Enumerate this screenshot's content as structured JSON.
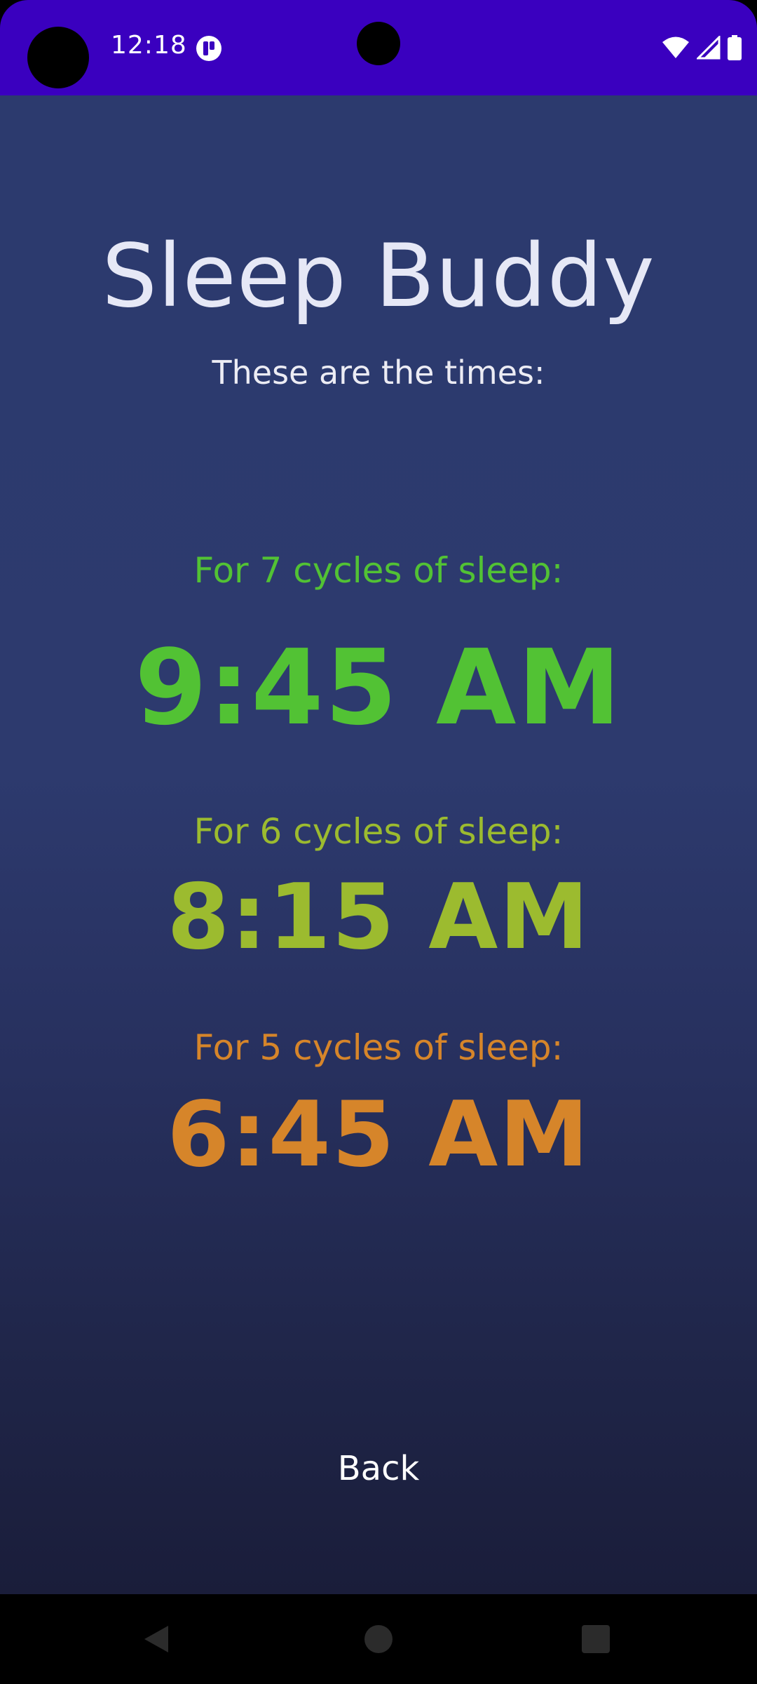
{
  "status_bar": {
    "time": "12:18",
    "icons": [
      "app-notification-icon",
      "wifi-icon",
      "cellular-signal-icon",
      "battery-icon"
    ]
  },
  "app": {
    "title": "Sleep Buddy",
    "subtitle": "These are the times:",
    "results": [
      {
        "label": "For 7 cycles of sleep:",
        "time": "9:45 AM",
        "color": "#52c234"
      },
      {
        "label": "For 6 cycles of sleep:",
        "time": "8:15 AM",
        "color": "#9cbb2f"
      },
      {
        "label": "For 5 cycles of sleep:",
        "time": "6:45 AM",
        "color": "#d6852a"
      }
    ],
    "back_label": "Back"
  },
  "colors": {
    "status_bar": "#3a00bf",
    "background_top": "#2c3a6e",
    "background_bottom": "#1a1d3a"
  },
  "nav_bar": {
    "icons": [
      "nav-back-icon",
      "nav-home-icon",
      "nav-recents-icon"
    ]
  }
}
